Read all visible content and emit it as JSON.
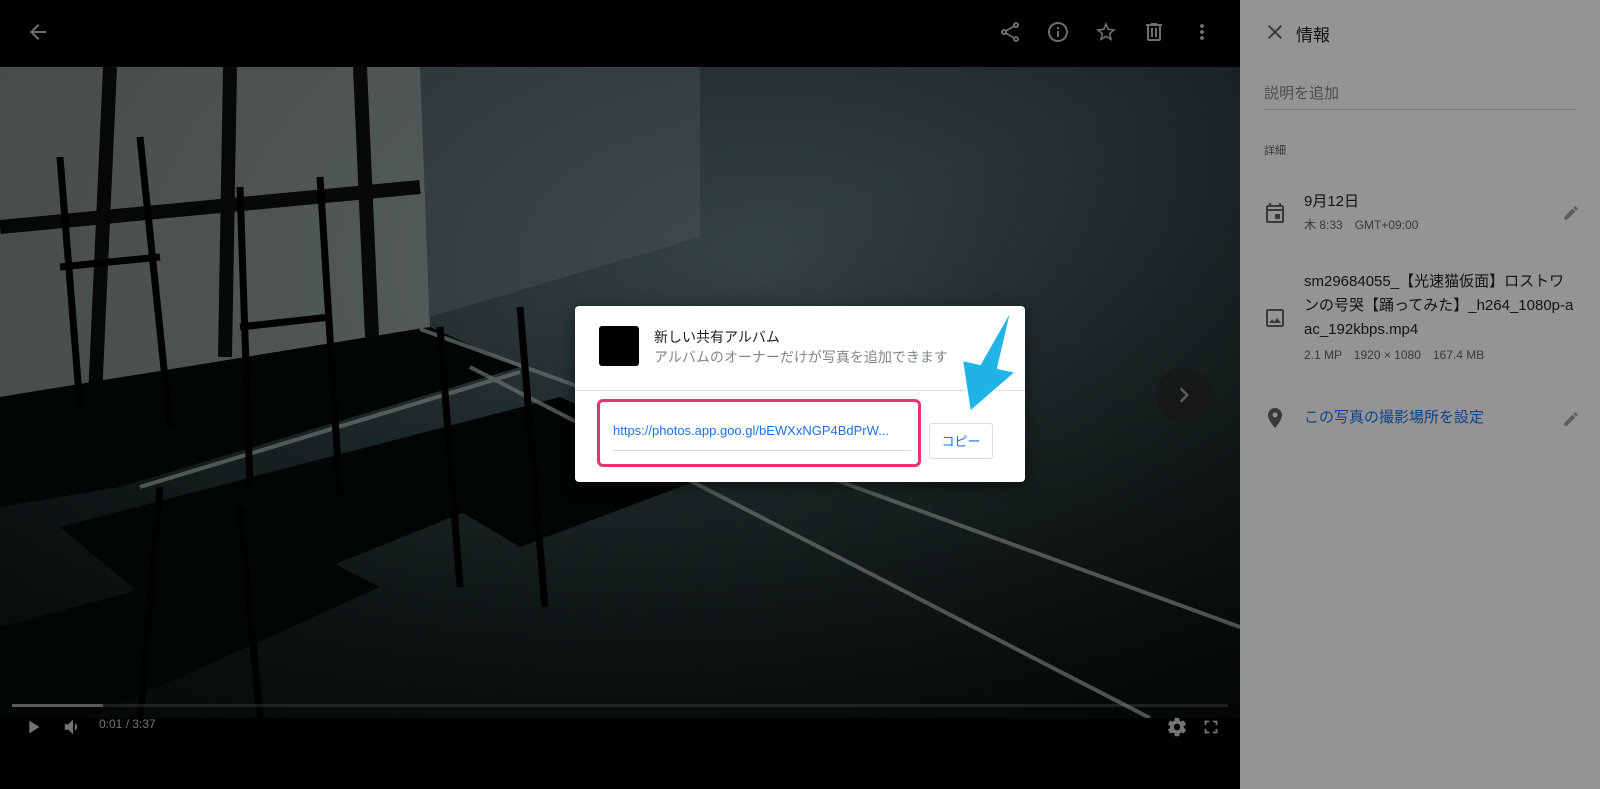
{
  "toolbar": {
    "back_icon": "arrow-back-icon",
    "share_icon": "share-icon",
    "info_icon": "info-icon",
    "favorite_icon": "star-icon",
    "delete_icon": "trash-icon",
    "more_icon": "more-vert-icon"
  },
  "video": {
    "time": "0:01 / 3:37",
    "progress_percent": 7.5
  },
  "panel": {
    "title": "情報",
    "description_placeholder": "説明を追加",
    "section_label": "詳細",
    "date": "9月12日",
    "datetime_sub": "木 8:33　GMT+09:00",
    "filename": "sm29684055_【光速猫仮面】ロストワンの号哭【踊ってみた】_h264_1080p-aac_192kbps.mp4",
    "file_meta": "2.1 MP　1920 × 1080　167.4 MB",
    "location_link": "この写真の撮影場所を設定"
  },
  "dialog": {
    "album_title": "新しい共有アルバム",
    "album_subtitle": "アルバムのオーナーだけが写真を追加できます",
    "share_link": "https://photos.app.goo.gl/bEWXxNGP4BdPrW...",
    "copy_label": "コピー"
  },
  "colors": {
    "highlight_border": "#e8336d",
    "annotation_arrow": "#1fb3e8",
    "link_blue": "#1a73e8"
  }
}
